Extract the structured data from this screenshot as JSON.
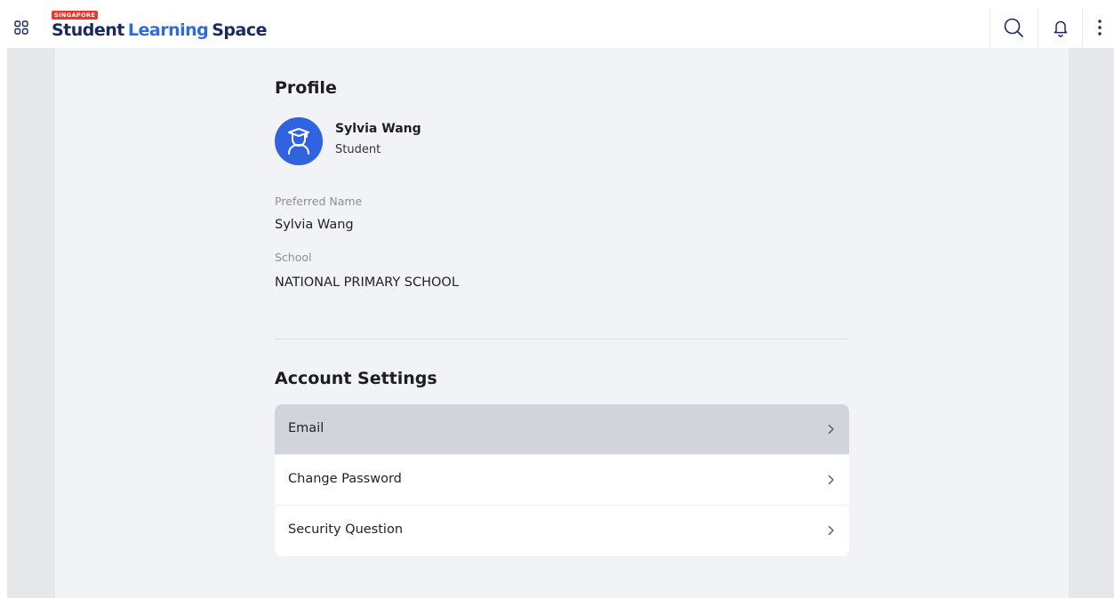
{
  "brand": {
    "badge": "SINGAPORE",
    "word1": "Student",
    "word2": "Learning",
    "word3": "Space"
  },
  "header": {
    "icons": [
      "apps-grid-icon",
      "search-icon",
      "bell-icon",
      "more-vertical-icon"
    ]
  },
  "profile": {
    "title": "Profile",
    "name": "Sylvia Wang",
    "role": "Student",
    "preferred_name_label": "Preferred Name",
    "preferred_name_value": "Sylvia Wang",
    "school_label": "School",
    "school_value": "NATIONAL PRIMARY SCHOOL",
    "avatar_icon": "student-graduate-icon"
  },
  "account": {
    "title": "Account Settings",
    "items": [
      {
        "label": "Email",
        "active": true
      },
      {
        "label": "Change Password",
        "active": false
      },
      {
        "label": "Security Question",
        "active": false
      }
    ]
  },
  "colors": {
    "accent": "#2f63e0",
    "brand_dark": "#1a2a5e",
    "badge_red": "#e03c31",
    "active_row": "#d1d4db"
  }
}
